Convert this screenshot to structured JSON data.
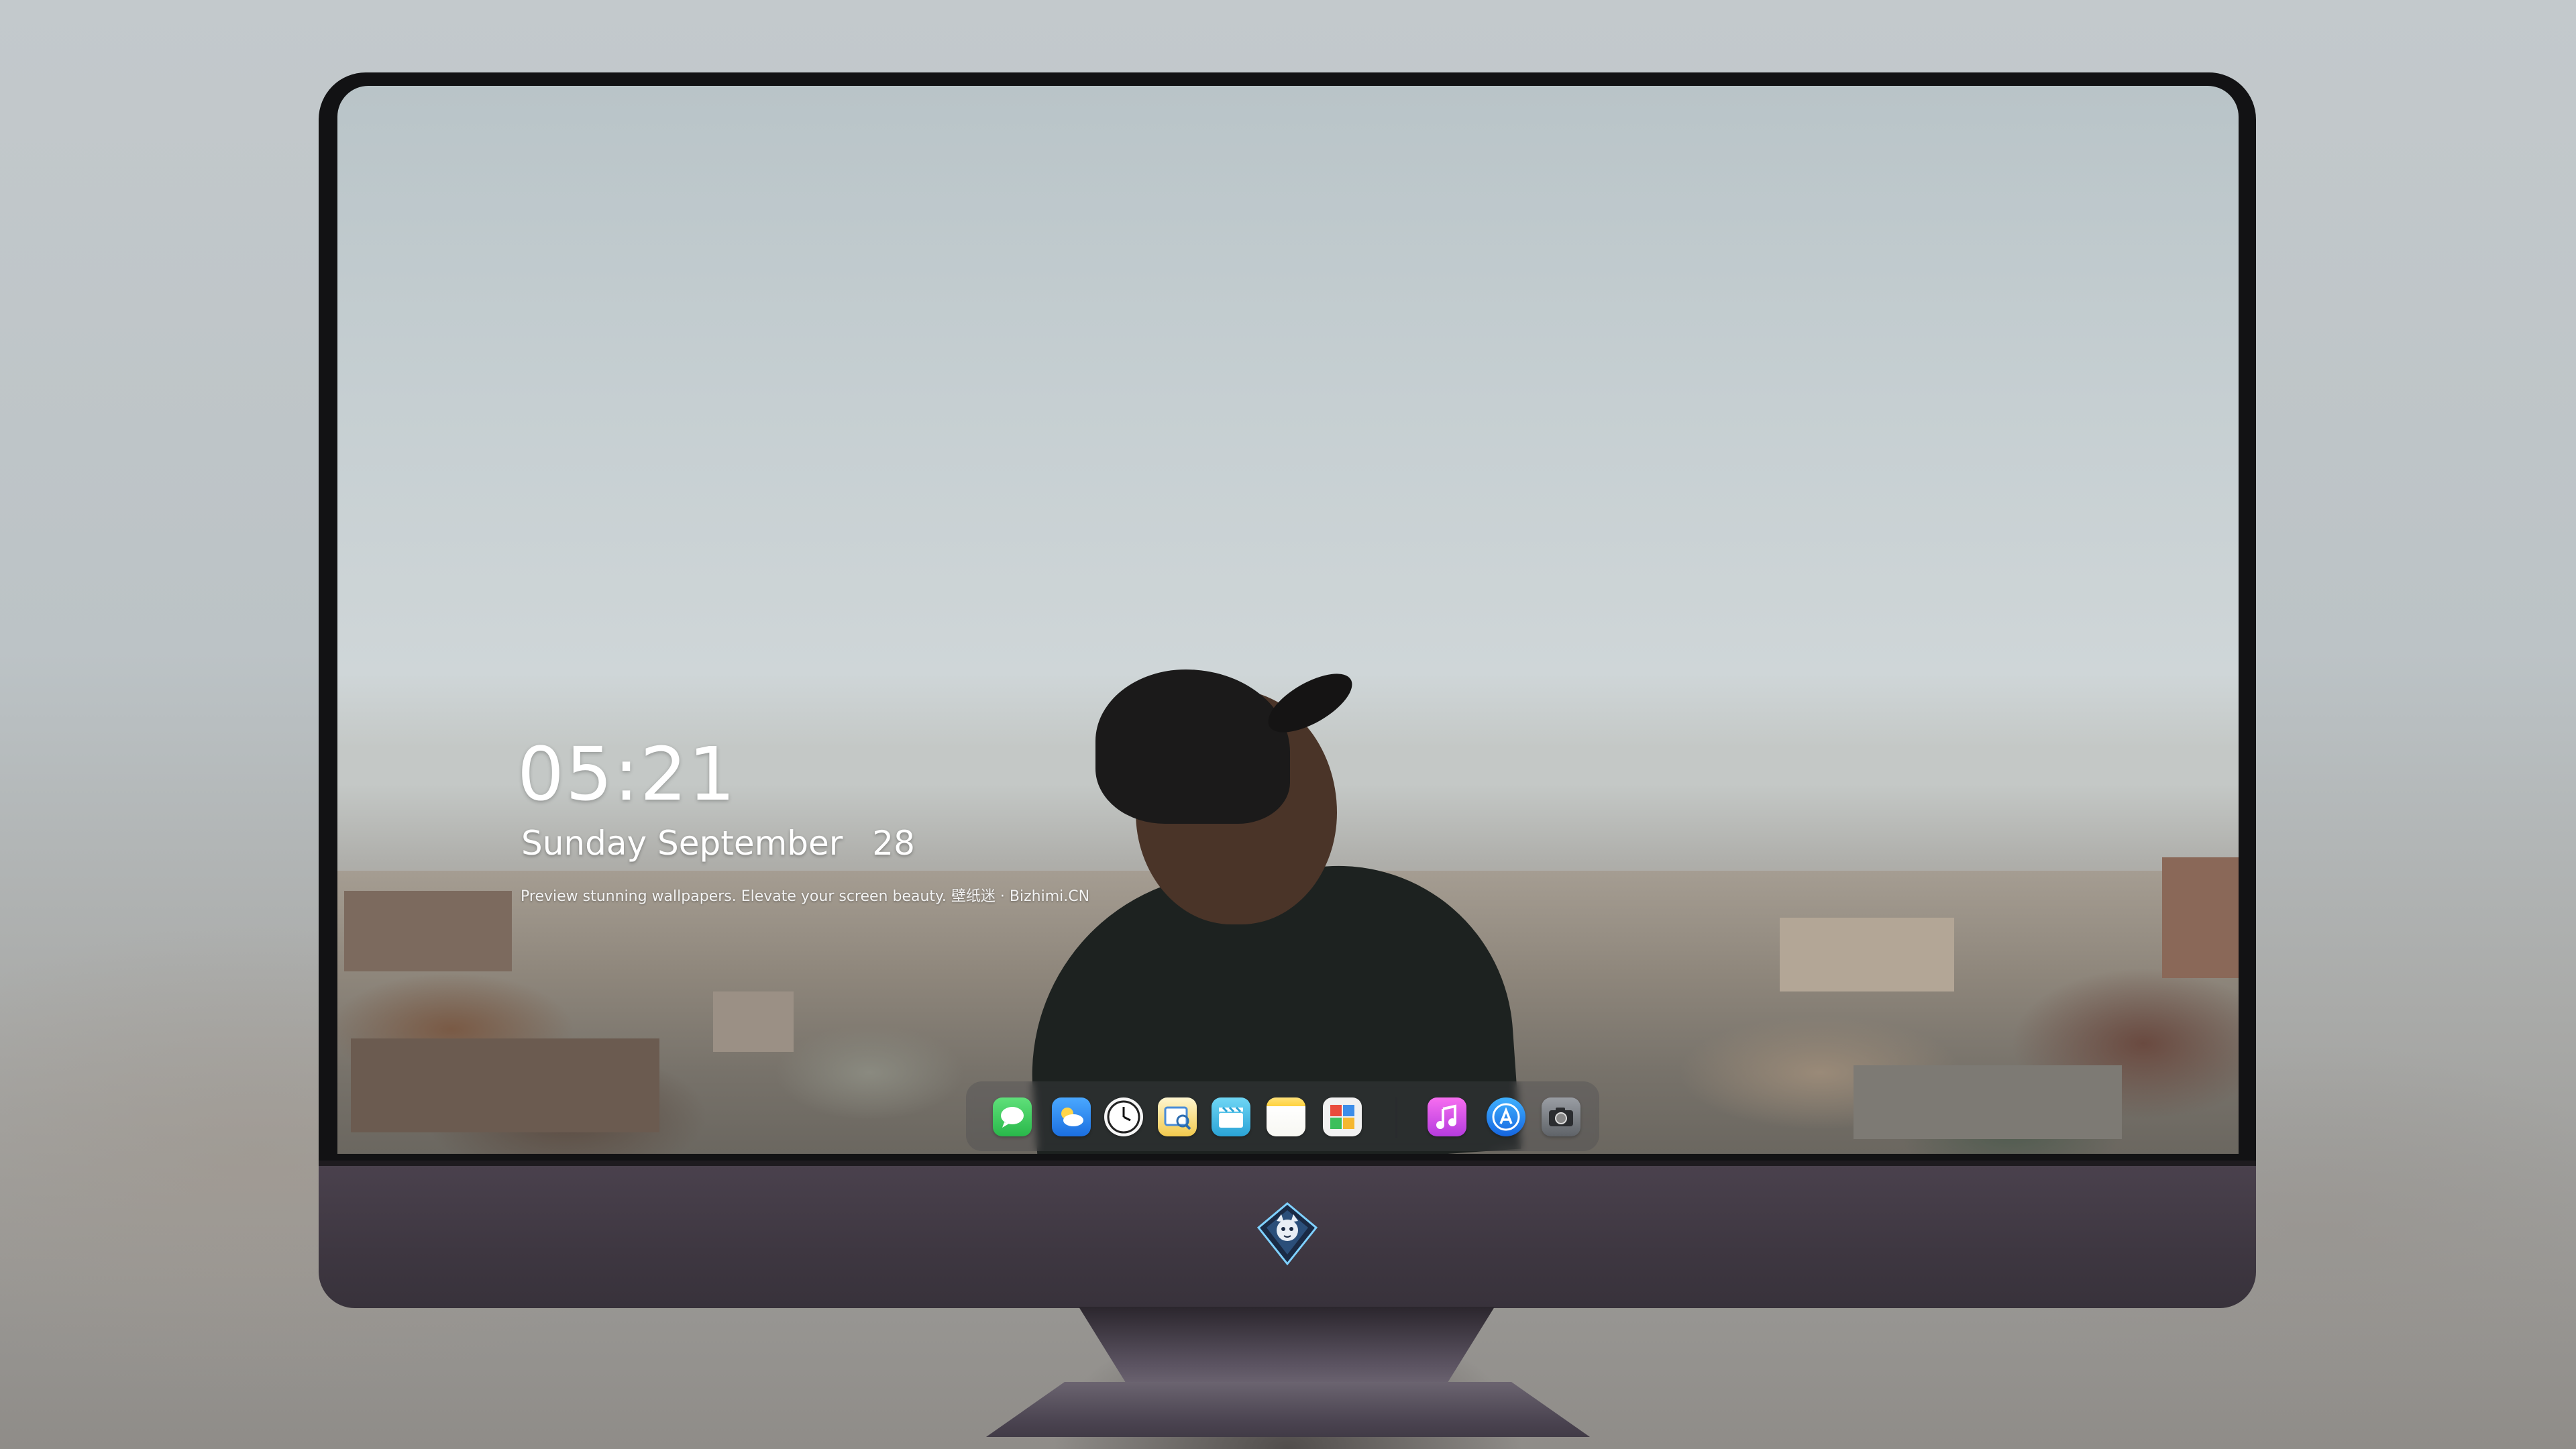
{
  "lock_screen": {
    "time": "05:21",
    "weekday": "Sunday",
    "month": "September",
    "day": "28",
    "caption": "Preview stunning wallpapers. Elevate your screen beauty. 壁纸迷 · Bizhimi.CN"
  },
  "dock": {
    "apps": [
      {
        "icon": "messages-icon",
        "color": "#34c759"
      },
      {
        "icon": "weather-icon",
        "color": "#2f8df5"
      },
      {
        "icon": "clock-icon",
        "color": "#f4f4f4"
      },
      {
        "icon": "preview-icon",
        "color": "#f1c232"
      },
      {
        "icon": "clips-icon",
        "color": "#4fc3e8"
      },
      {
        "icon": "notes-icon",
        "color": "#ffd54a"
      },
      {
        "icon": "photo-booth-icon",
        "color": "#e8e8e8"
      },
      {
        "icon": "music-icon",
        "color": "#e040fb"
      },
      {
        "icon": "app-store-icon",
        "color": "#1e88e5"
      },
      {
        "icon": "camera-icon",
        "color": "#5f6368"
      }
    ]
  },
  "colors": {
    "monitor_chin": "#3e3741",
    "bezel": "#121214",
    "sky": "#c6cfd2"
  }
}
